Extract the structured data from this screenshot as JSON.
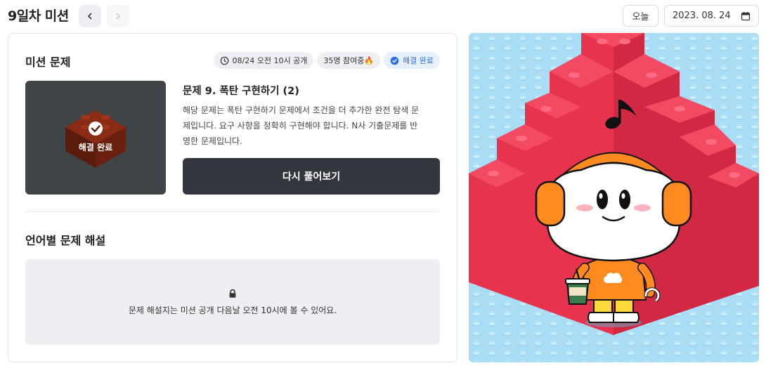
{
  "header": {
    "title": "9일차 미션",
    "prev_icon": "chevron-left-icon",
    "next_icon": "chevron-right-icon",
    "today_label": "오늘",
    "date_value": "2023. 08. 24",
    "calendar_icon": "calendar-icon"
  },
  "mission": {
    "section_title": "미션 문제",
    "badges": {
      "release": "08/24 오전 10시 공개",
      "participants": "35명 참여중🔥",
      "status": "해결 완료"
    },
    "thumbnail_label": "해결 완료",
    "problem_title": "문제 9. 폭탄 구현하기 (2)",
    "problem_desc_lines": [
      "해당 문제는 폭탄 구현하기 문제에서 조건을 더 추가한 완전 탐색 문",
      "제입니다. 요구 사항을 정확히 구현해야 합니다. N사 기출문제를 반",
      "영한 문제입니다."
    ],
    "retry_label": "다시 풀어보기"
  },
  "solutions": {
    "section_title": "언어별 문제 해설",
    "locked_message": "문제 해설지는 미션 공개 다음날 오전 10시에 볼 수 있어요."
  },
  "colors": {
    "primary_dark": "#33363d",
    "badge_done": "#2f6fe0",
    "lego_red": "#e8334f",
    "sky": "#a9ddf5",
    "mascot_orange": "#ff8a1f"
  }
}
